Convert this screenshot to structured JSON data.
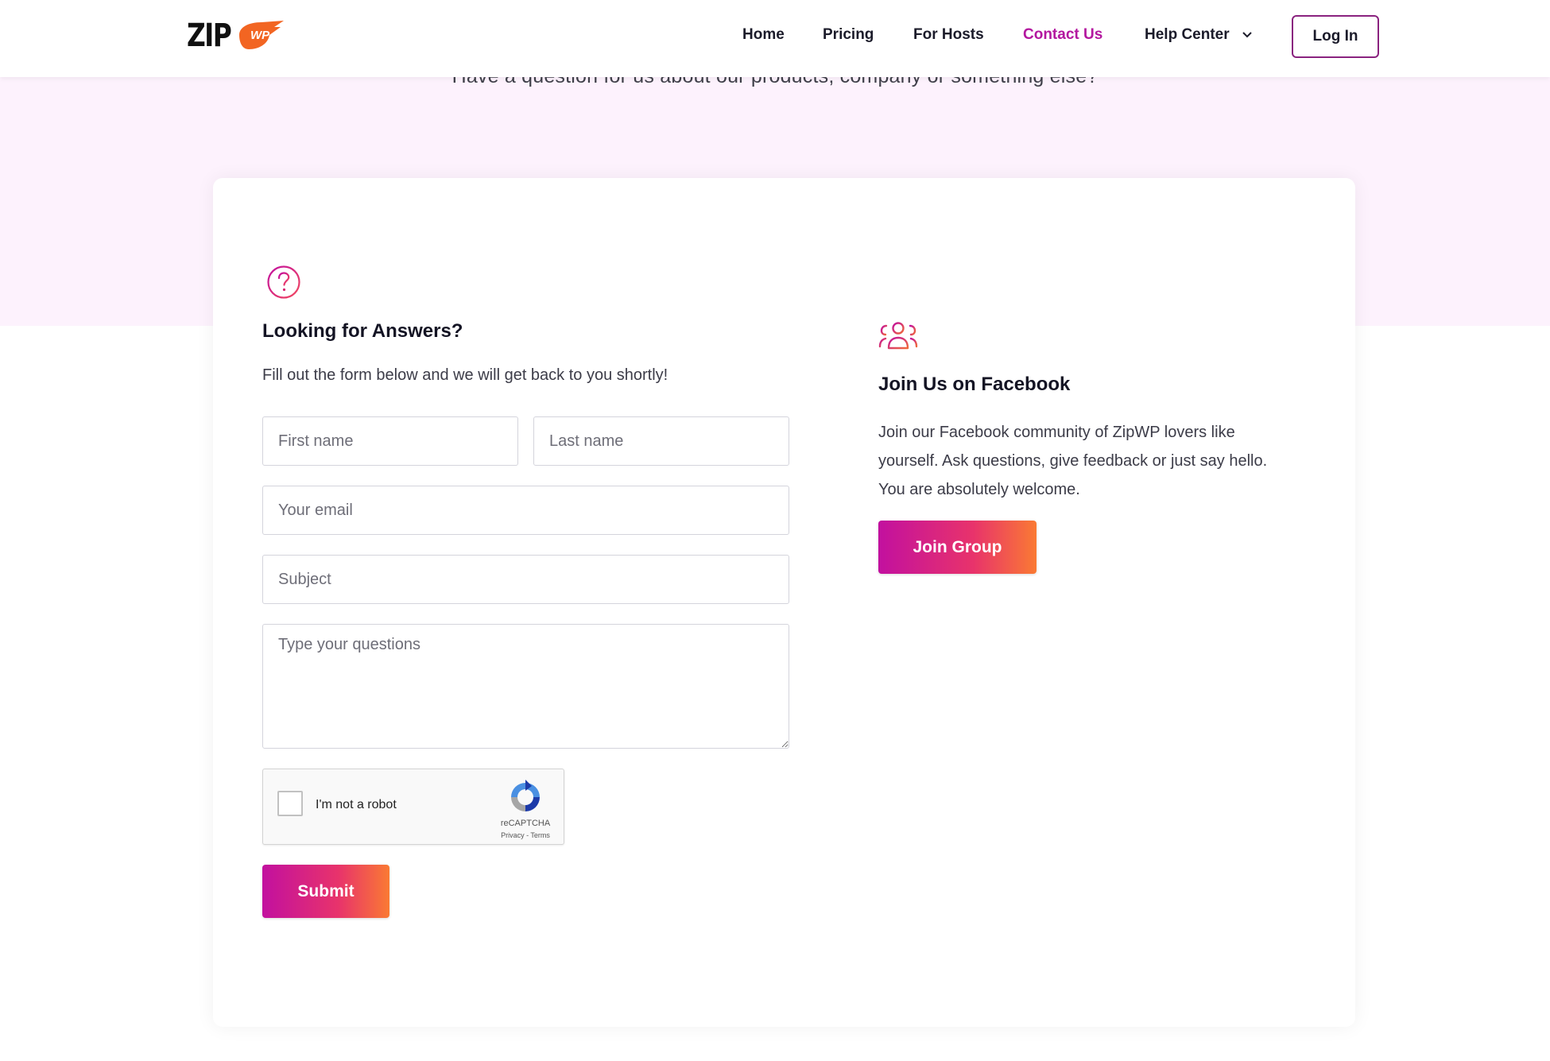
{
  "header": {
    "logo_text": "ZIP",
    "logo_badge": "WP",
    "nav": [
      {
        "label": "Home"
      },
      {
        "label": "Pricing"
      },
      {
        "label": "For Hosts"
      },
      {
        "label": "Contact Us"
      },
      {
        "label": "Help Center"
      }
    ],
    "login_label": "Log In"
  },
  "hero": {
    "subtitle": "Have a question for us about our products, company or something else?"
  },
  "form_section": {
    "icon": "question-circle-icon",
    "title": "Looking for Answers?",
    "description": "Fill out the form below and we will get back to you shortly!",
    "fields": {
      "first_name": {
        "placeholder": "First name",
        "value": ""
      },
      "last_name": {
        "placeholder": "Last name",
        "value": ""
      },
      "email": {
        "placeholder": "Your email",
        "value": ""
      },
      "subject": {
        "placeholder": "Subject",
        "value": ""
      },
      "message": {
        "placeholder": "Type your questions",
        "value": ""
      }
    },
    "captcha": {
      "label": "I'm not a robot",
      "brand": "reCAPTCHA",
      "links": "Privacy - Terms"
    },
    "submit_label": "Submit"
  },
  "facebook_section": {
    "icon": "users-group-icon",
    "title": "Join Us on Facebook",
    "description_lines": [
      "Join our Facebook community of ZipWP lovers like",
      "yourself. Ask questions, give feedback or just say hello.",
      "You are absolutely welcome."
    ],
    "button_label": "Join Group"
  },
  "colors": {
    "accent": "#b3179f",
    "gradient_start": "#c2109f",
    "gradient_end": "#fa7a33",
    "hero_bg": "#fdf2fd",
    "logo_orange": "#f26522"
  }
}
